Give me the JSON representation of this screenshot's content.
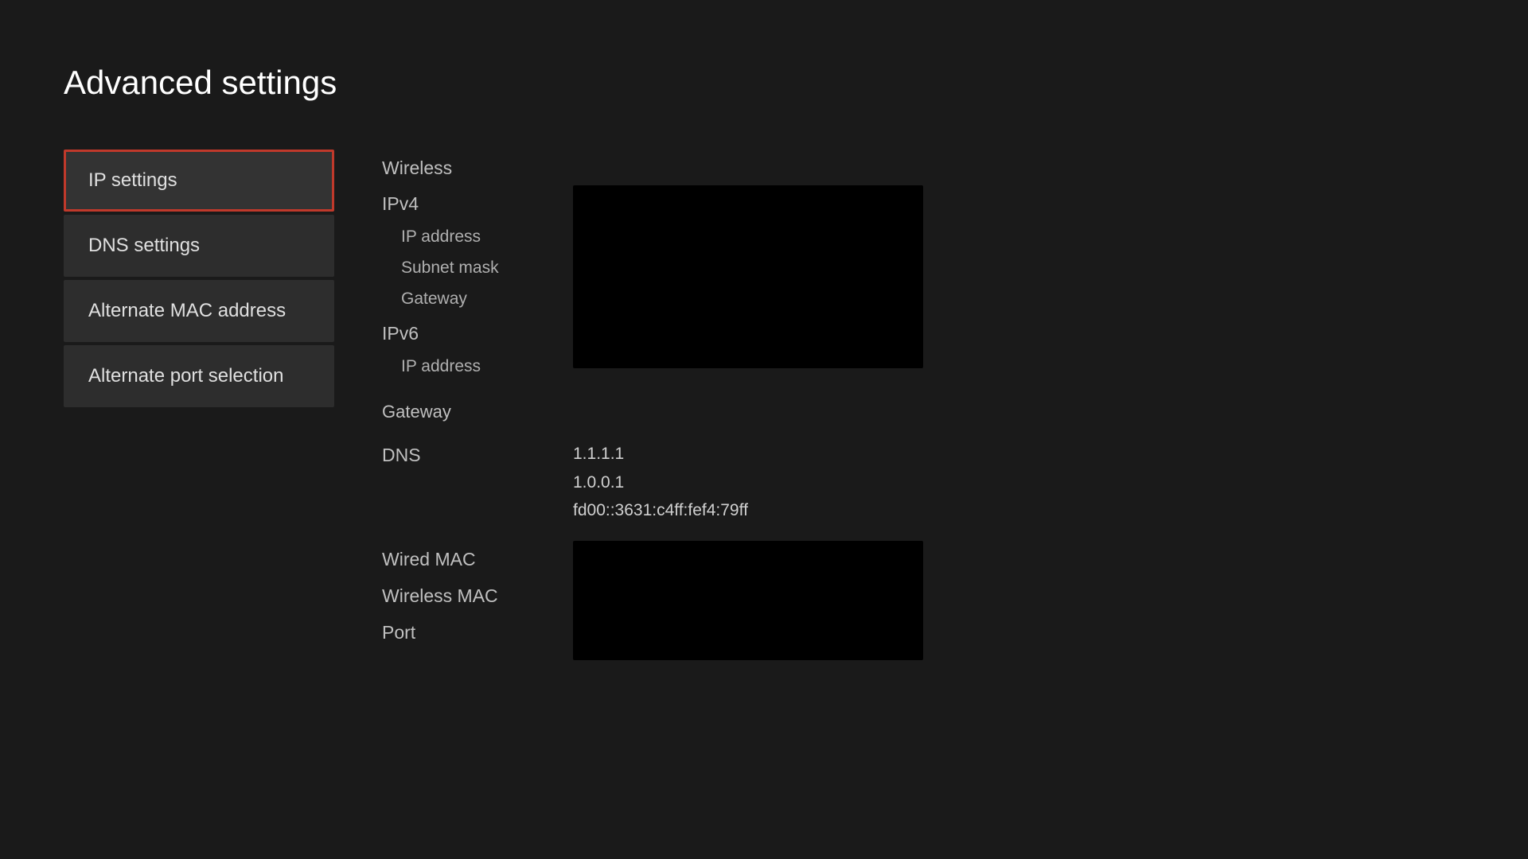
{
  "page": {
    "title": "Advanced settings"
  },
  "sidebar": {
    "items": [
      {
        "id": "ip-settings",
        "label": "IP settings",
        "active": true
      },
      {
        "id": "dns-settings",
        "label": "DNS settings",
        "active": false
      },
      {
        "id": "alternate-mac",
        "label": "Alternate MAC address",
        "active": false
      },
      {
        "id": "alternate-port",
        "label": "Alternate port selection",
        "active": false
      }
    ]
  },
  "main": {
    "wireless_label": "Wireless",
    "ipv4": {
      "header": "IPv4",
      "ip_address": "IP address",
      "subnet_mask": "Subnet mask",
      "gateway": "Gateway"
    },
    "ipv6": {
      "header": "IPv6",
      "ip_address": "IP address",
      "gateway": "Gateway"
    },
    "dns": {
      "label": "DNS",
      "values": [
        "1.1.1.1",
        "1.0.0.1",
        "fd00::3631:c4ff:fef4:79ff"
      ]
    },
    "wired_mac": "Wired MAC",
    "wireless_mac": "Wireless MAC",
    "port": "Port"
  }
}
